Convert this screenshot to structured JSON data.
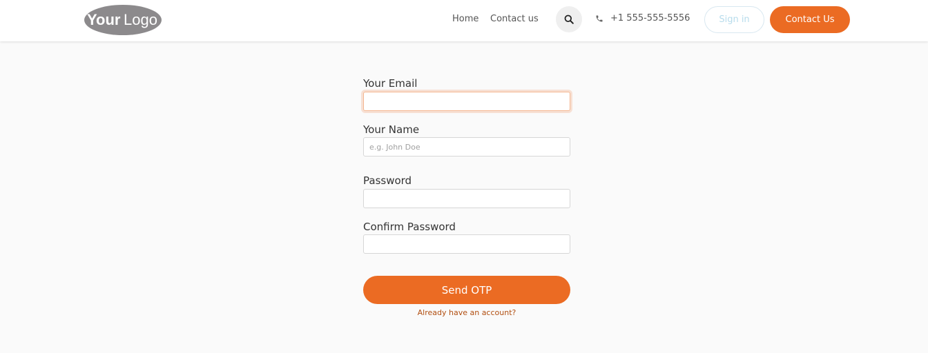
{
  "header": {
    "logo_text_bold": "Your",
    "logo_text_light": "Logo",
    "nav": [
      {
        "label": "Home"
      },
      {
        "label": "Contact us"
      }
    ],
    "search_icon": "search-icon",
    "phone_icon": "phone-icon",
    "phone": "+1 555-555-5556",
    "sign_in_label": "Sign in",
    "contact_label": "Contact Us"
  },
  "form": {
    "email": {
      "label": "Your Email",
      "value": "",
      "placeholder": ""
    },
    "name": {
      "label": "Your Name",
      "value": "",
      "placeholder": "e.g. John Doe"
    },
    "password": {
      "label": "Password",
      "value": "",
      "placeholder": ""
    },
    "confirm_password": {
      "label": "Confirm Password",
      "value": "",
      "placeholder": ""
    },
    "submit_label": "Send OTP",
    "login_link": "Already have an account?"
  },
  "colors": {
    "accent": "#eb6b23",
    "link": "#b14e10",
    "logo": "#8c8a8c"
  }
}
